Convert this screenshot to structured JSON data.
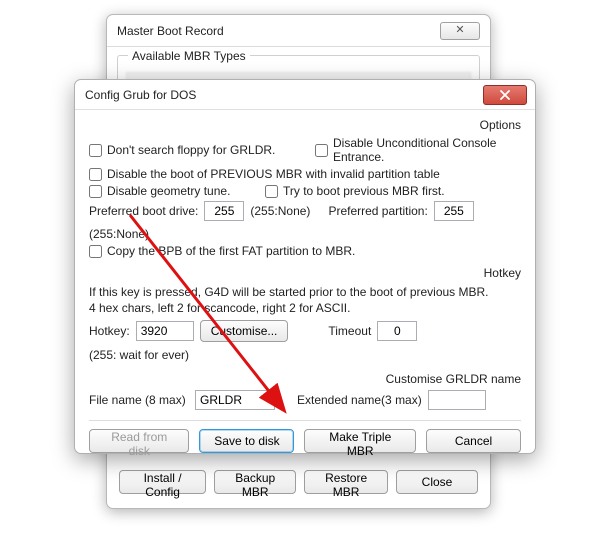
{
  "back_window": {
    "title": "Master Boot Record",
    "close_glyph": "✕",
    "fieldset_legend": "Available MBR Types",
    "buttons": {
      "install_config": "Install / Config",
      "backup_mbr": "Backup MBR",
      "restore_mbr": "Restore MBR",
      "close": "Close"
    }
  },
  "front_dialog": {
    "title": "Config Grub for DOS",
    "sections": {
      "options_title": "Options",
      "hotkey_title": "Hotkey",
      "grldr_title": "Customise GRLDR name"
    },
    "checkboxes": {
      "no_floppy": "Don't search floppy for GRLDR.",
      "disable_console": "Disable Unconditional Console Entrance.",
      "disable_prev_boot": "Disable the boot of PREVIOUS MBR with invalid partition table",
      "disable_geometry": "Disable geometry tune.",
      "try_prev_mbr": "Try to boot previous MBR first.",
      "copy_bpb": "Copy the BPB of the first FAT partition to MBR."
    },
    "labels": {
      "pref_drive": "Preferred boot drive:",
      "drive_none": "(255:None)",
      "pref_partition": "Preferred partition:",
      "partition_none": "(255:None)",
      "hotkey_note": "If this key is pressed, G4D will be started prior to the boot  of previous MBR.\n4 hex chars, left 2 for scancode, right 2 for ASCII.",
      "hotkey_label": "Hotkey:",
      "customise_btn": "Customise...",
      "timeout_label": "Timeout",
      "timeout_note": "(255: wait for ever)",
      "filename_label": "File name (8 max)",
      "extname_label": "Extended name(3 max)"
    },
    "values": {
      "pref_drive": "255",
      "pref_partition": "255",
      "hotkey": "3920",
      "timeout": "0",
      "filename": "GRLDR",
      "extname": ""
    },
    "buttons": {
      "read_disk": "Read from disk",
      "save_disk": "Save to disk",
      "make_triple": "Make Triple MBR",
      "cancel": "Cancel"
    }
  }
}
